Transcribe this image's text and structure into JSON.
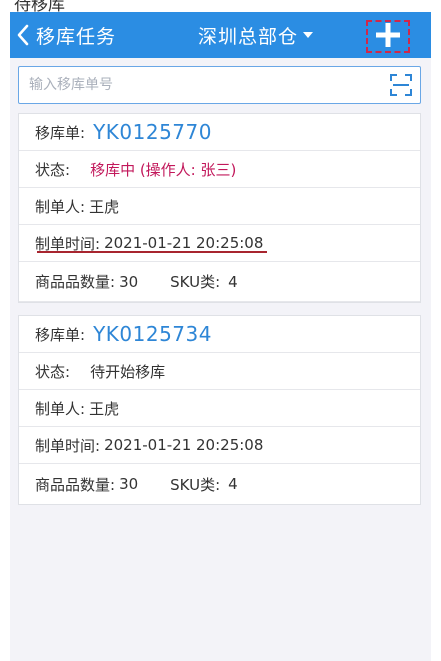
{
  "top_strip": {
    "text": "待移库"
  },
  "navbar": {
    "back_icon": "chevron-left-icon",
    "title": "移库任务",
    "warehouse": "深圳总部仓",
    "add_icon": "plus-icon"
  },
  "search": {
    "placeholder": "输入移库单号",
    "value": "",
    "scan_icon": "scan-icon"
  },
  "colors": {
    "navbar": "#2b8de3",
    "order_no": "#2e86d6",
    "status_active": "#c2185b",
    "highlight_border": "#d0284a"
  },
  "labels": {
    "order": "移库单:",
    "status": "状态:",
    "creator": "制单人:",
    "created_time": "制单时间:",
    "qty": "商品品数量:",
    "sku": "SKU类:"
  },
  "orders": [
    {
      "order_no": "YK0125770",
      "status": "移库中 (操作人: 张三)",
      "creator": "王虎",
      "created_time": "2021-01-21 20:25:08",
      "qty": "30",
      "sku": "4"
    },
    {
      "order_no": "YK0125734",
      "status": "待开始移库",
      "creator": "王虎",
      "created_time": "2021-01-21 20:25:08",
      "qty": "30",
      "sku": "4"
    }
  ]
}
